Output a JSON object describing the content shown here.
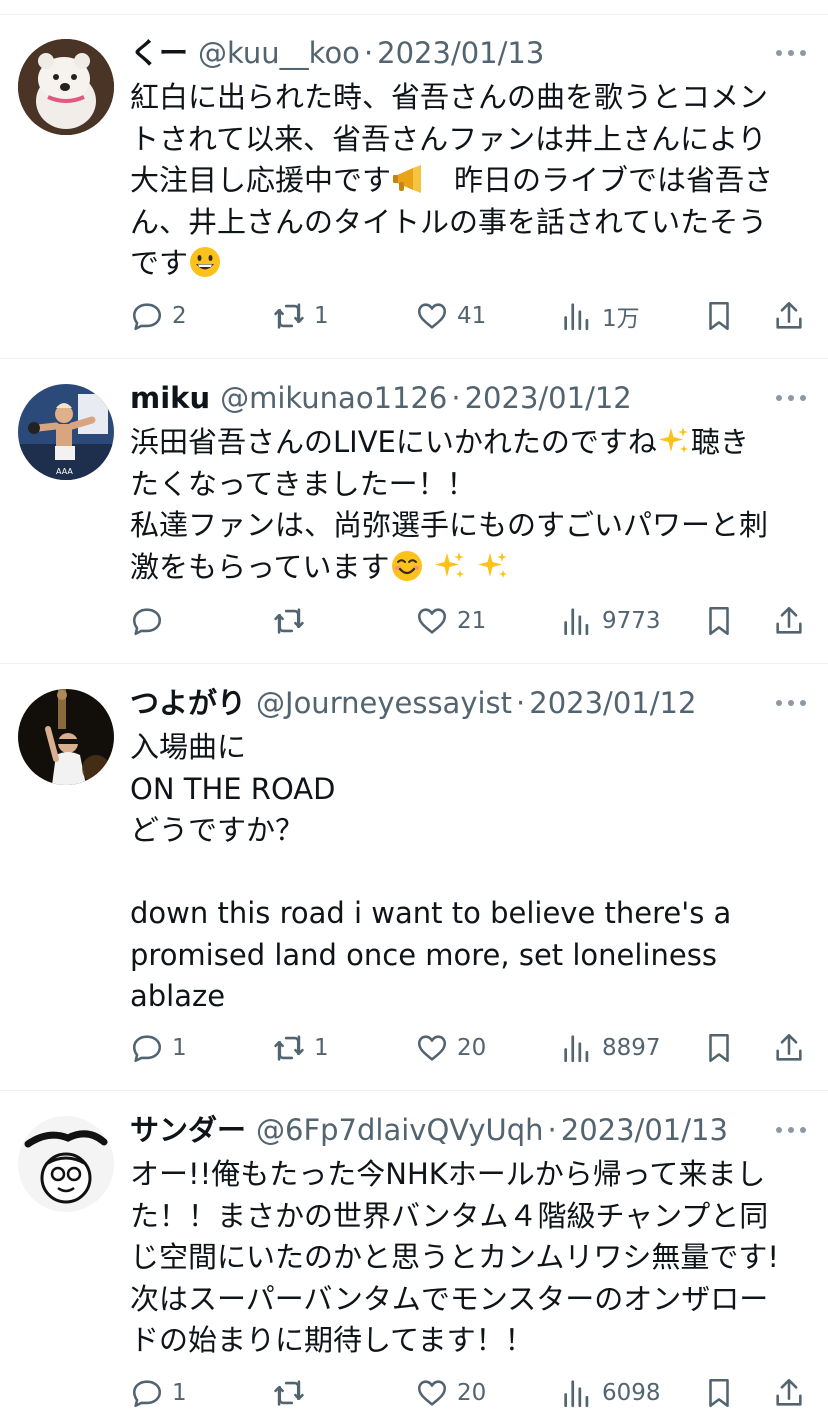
{
  "tweets": [
    {
      "name": "くー",
      "handle": "@kuu__koo",
      "sep": "·",
      "date": "2023/01/13",
      "lines": [
        "紅白に出られた時、省吾さんの曲を歌うとコメン",
        "トされて以来、省吾さんファンは井上さんにより",
        "大注目し応援中です",
        "　昨日のライブでは省吾さ",
        "ん、井上さんのタイトルの事を話されていたそう",
        "です"
      ],
      "emojis": [
        "megaphone",
        "grinning-face"
      ],
      "replies": "2",
      "retweets": "1",
      "likes": "41",
      "views": "1万"
    },
    {
      "name": "miku",
      "handle": "@mikunao1126",
      "sep": "·",
      "date": "2023/01/12",
      "lines": [
        "浜田省吾さんのLIVEにいかれたのですね",
        "聴き",
        "たくなってきましたー！！",
        "私達ファンは、尚弥選手にものすごいパワーと刺",
        "激をもらっています"
      ],
      "emojis": [
        "sparkles",
        "smiling-face",
        "sparkles",
        "sparkles"
      ],
      "replies": "",
      "retweets": "",
      "likes": "21",
      "views": "9773"
    },
    {
      "name": "つよがり",
      "handle": "@Journeyessayist",
      "sep": "·",
      "date": "2023/01/12",
      "lines": [
        "入場曲に",
        "ON THE ROAD",
        "どうですか？",
        "",
        "down this road i want to believe there's a",
        "promised land once more, set loneliness",
        "ablaze"
      ],
      "replies": "1",
      "retweets": "1",
      "likes": "20",
      "views": "8897"
    },
    {
      "name": "サンダー",
      "handle": "@6Fp7dlaivQVyUqh",
      "sep": "·",
      "date": "2023/01/13",
      "lines": [
        "オー!!俺もたった今NHKホールから帰って来まし",
        "た！！まさかの世界バンタム４階級チャンプと同",
        "じ空間にいたのかと思うとカンムリワシ無量です!",
        "次はスーパーバンタムでモンスターのオンザロー",
        "ドの始まりに期待してます！！"
      ],
      "replies": "1",
      "retweets": "",
      "likes": "20",
      "views": "6098"
    }
  ],
  "colors": {
    "text": "#0f1419",
    "muted": "#536471",
    "divider": "#eff3f4"
  },
  "icons": [
    "reply-icon",
    "retweet-icon",
    "like-icon",
    "views-icon",
    "bookmark-icon",
    "share-icon",
    "more-icon"
  ]
}
